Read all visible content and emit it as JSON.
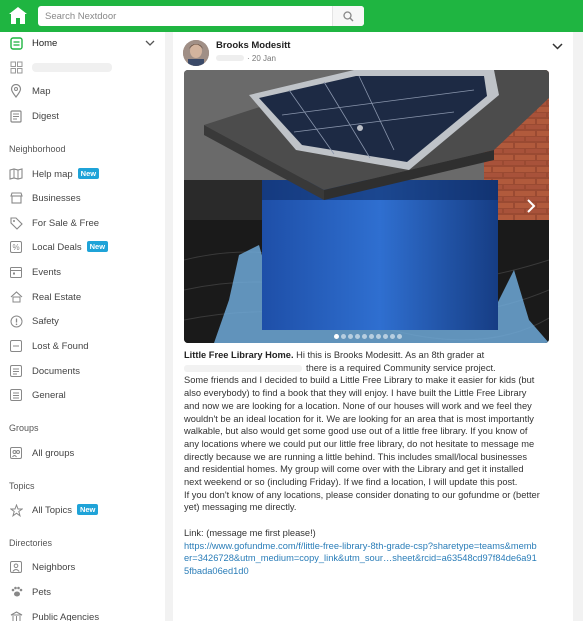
{
  "search": {
    "placeholder": "Search Nextdoor"
  },
  "colors": {
    "brand": "#1fb541",
    "badge": "#1fa3d8",
    "link": "#2a7db8",
    "feed_bg": "#f2f2f2"
  },
  "sidebar": {
    "home": "Home",
    "map": "Map",
    "digest": "Digest",
    "neighborhood_header": "Neighborhood",
    "neighborhood_items": [
      {
        "label": "Help map",
        "badge": "New",
        "icon": "map-icon"
      },
      {
        "label": "Businesses",
        "badge": "",
        "icon": "store-icon"
      },
      {
        "label": "For Sale & Free",
        "badge": "",
        "icon": "tag-icon"
      },
      {
        "label": "Local Deals",
        "badge": "New",
        "icon": "percent-icon"
      },
      {
        "label": "Events",
        "badge": "",
        "icon": "calendar-icon"
      },
      {
        "label": "Real Estate",
        "badge": "",
        "icon": "house-icon"
      },
      {
        "label": "Safety",
        "badge": "",
        "icon": "alert-icon"
      },
      {
        "label": "Lost & Found",
        "badge": "",
        "icon": "lost-found-icon"
      },
      {
        "label": "Documents",
        "badge": "",
        "icon": "document-icon"
      },
      {
        "label": "General",
        "badge": "",
        "icon": "general-icon"
      }
    ],
    "groups_header": "Groups",
    "all_groups": "All groups",
    "topics_header": "Topics",
    "all_topics": "All Topics",
    "all_topics_badge": "New",
    "directories_header": "Directories",
    "neighbors": "Neighbors",
    "pets": "Pets",
    "public_agencies": "Public Agencies"
  },
  "post": {
    "author": "Brooks Modesitt",
    "date": "20 Jan",
    "title": "Little Free Library Home.",
    "intro": " Hi this is Brooks Modesitt. As an 8th grader at",
    "line2": "there is a required Community service project.",
    "body": "Some friends and I decided to build a Little Free Library to make it easier for kids (but also everybody) to find a book that they will enjoy. I have built the Little Free Library and now we are looking for a location. None of our houses will work and we feel they wouldn't be an ideal location for it. We are looking for an area that is most importantly walkable, but also would get some good use out of a little free library. If you know of any locations where we could put our little free library, do not hesitate to message me directly because we are running a little behind. This includes small/local businesses and residential homes. My group will come over with the Library and get it installed next weekend or so (including Friday). If we find a location, I will update this post.",
    "donate": "If you don't know of any locations, please consider donating to our gofundme or (better yet) messaging me directly.",
    "link_label": "Link: (message me first please!)",
    "link_url": "https://www.gofundme.com/f/little-free-library-8th-grade-csp?sharetype=teams&member=3426728&utm_medium=copy_link&utm_sour…sheet&rcid=a63548cd97f84de6a915fbada06ed1d0",
    "photo_count": 10,
    "photo_index": 1
  }
}
